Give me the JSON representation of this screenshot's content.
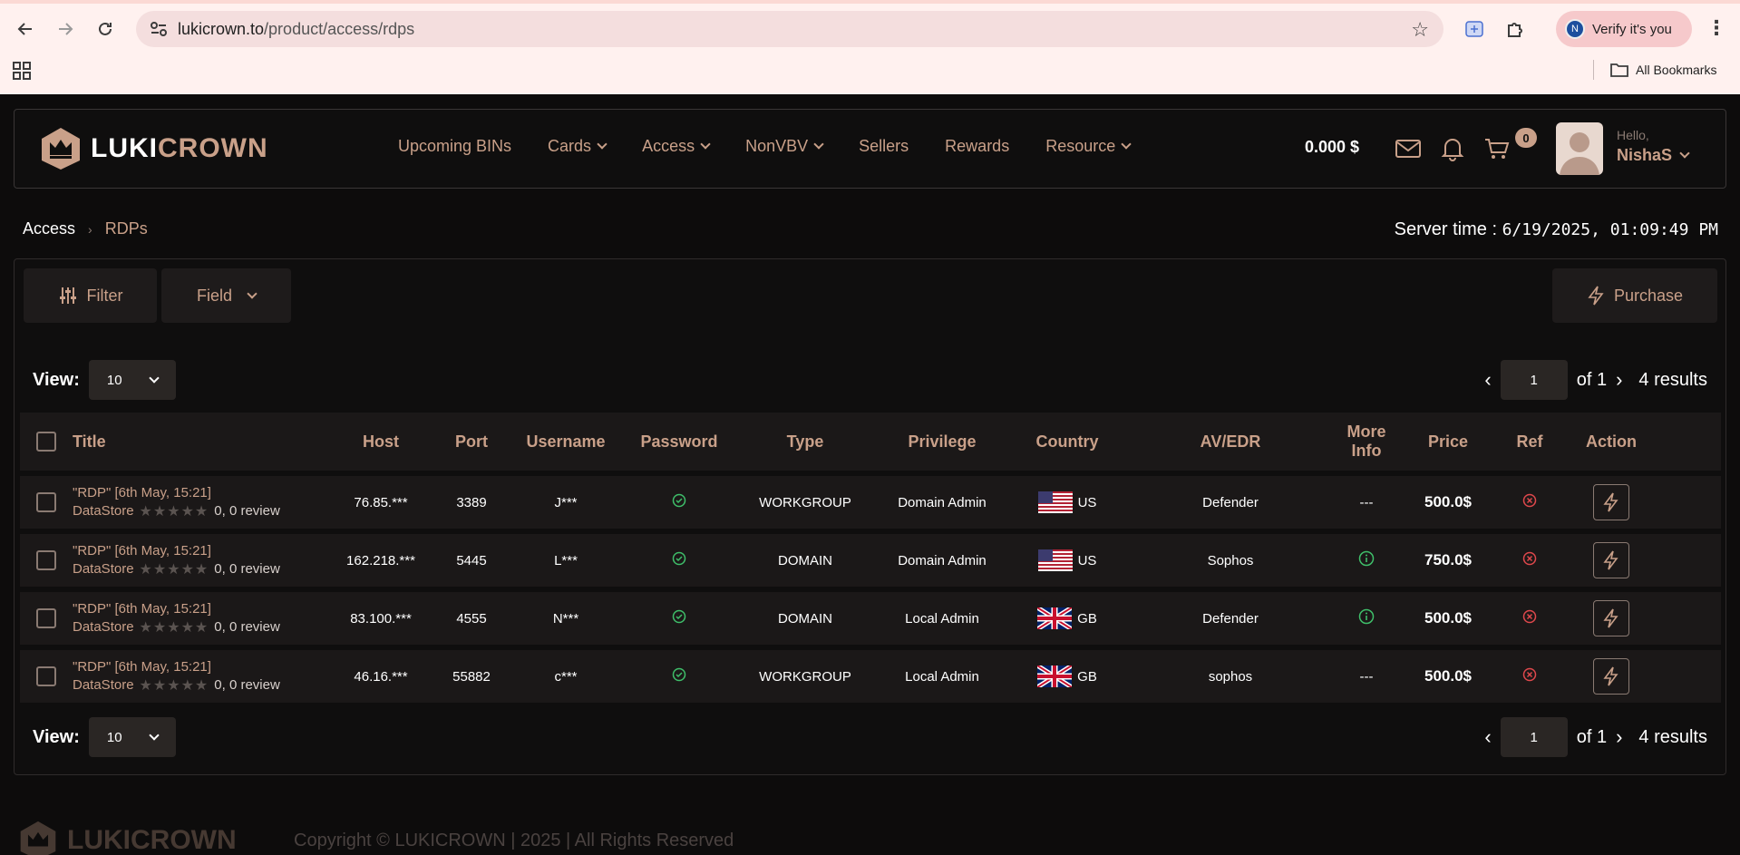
{
  "browser": {
    "url_host": "lukicrown.to",
    "url_path": "/product/access/rdps",
    "profile_initial": "N",
    "verify_label": "Verify it's you",
    "all_bookmarks": "All Bookmarks"
  },
  "header": {
    "logo_part1": "LUKI",
    "logo_part2": "CROWN",
    "nav": [
      {
        "label": "Upcoming BINs",
        "dropdown": false
      },
      {
        "label": "Cards",
        "dropdown": true
      },
      {
        "label": "Access",
        "dropdown": true
      },
      {
        "label": "NonVBV",
        "dropdown": true
      },
      {
        "label": "Sellers",
        "dropdown": false
      },
      {
        "label": "Rewards",
        "dropdown": false
      },
      {
        "label": "Resource",
        "dropdown": true
      }
    ],
    "balance": "0.000 $",
    "cart_count": "0",
    "hello": "Hello,",
    "username": "NishaS"
  },
  "breadcrumb": {
    "parent": "Access",
    "separator": "›",
    "current": "RDPs"
  },
  "server_time": {
    "label": "Server time : ",
    "value": "6/19/2025, 01:09:49 PM"
  },
  "toolbar": {
    "filter_label": "Filter",
    "field_label": "Field",
    "purchase_label": "Purchase"
  },
  "pagination": {
    "view_label": "View:",
    "page_size": "10",
    "page": "1",
    "of_label": "of 1",
    "results": "4 results"
  },
  "table": {
    "columns": [
      "Title",
      "Host",
      "Port",
      "Username",
      "Password",
      "Type",
      "Privilege",
      "Country",
      "AV/EDR",
      "More Info",
      "Price",
      "Ref",
      "Action"
    ],
    "rows": [
      {
        "title": "\"RDP\" [6th May, 15:21]",
        "seller": "DataStore",
        "reviews": "0, 0 review",
        "host": "76.85.***",
        "port": "3389",
        "username": "J***",
        "type": "WORKGROUP",
        "privilege": "Domain Admin",
        "country": "US",
        "av": "Defender",
        "more_info": "---",
        "price": "500.0$"
      },
      {
        "title": "\"RDP\" [6th May, 15:21]",
        "seller": "DataStore",
        "reviews": "0, 0 review",
        "host": "162.218.***",
        "port": "5445",
        "username": "L***",
        "type": "DOMAIN",
        "privilege": "Domain Admin",
        "country": "US",
        "av": "Sophos",
        "more_info": "info-icon",
        "price": "750.0$"
      },
      {
        "title": "\"RDP\" [6th May, 15:21]",
        "seller": "DataStore",
        "reviews": "0, 0 review",
        "host": "83.100.***",
        "port": "4555",
        "username": "N***",
        "type": "DOMAIN",
        "privilege": "Local Admin",
        "country": "GB",
        "av": "Defender",
        "more_info": "info-icon",
        "price": "500.0$"
      },
      {
        "title": "\"RDP\" [6th May, 15:21]",
        "seller": "DataStore",
        "reviews": "0, 0 review",
        "host": "46.16.***",
        "port": "55882",
        "username": "c***",
        "type": "WORKGROUP",
        "privilege": "Local Admin",
        "country": "GB",
        "av": "sophos",
        "more_info": "---",
        "price": "500.0$"
      }
    ]
  },
  "footer": {
    "logo": "LUKICROWN",
    "copyright": "Copyright © LUKICROWN | 2025 | All Rights Reserved"
  },
  "colors": {
    "accent": "#c9a089",
    "background": "#0d0c0c",
    "row": "#1b1818",
    "success": "#3fbf6a",
    "danger": "#e0484c"
  }
}
